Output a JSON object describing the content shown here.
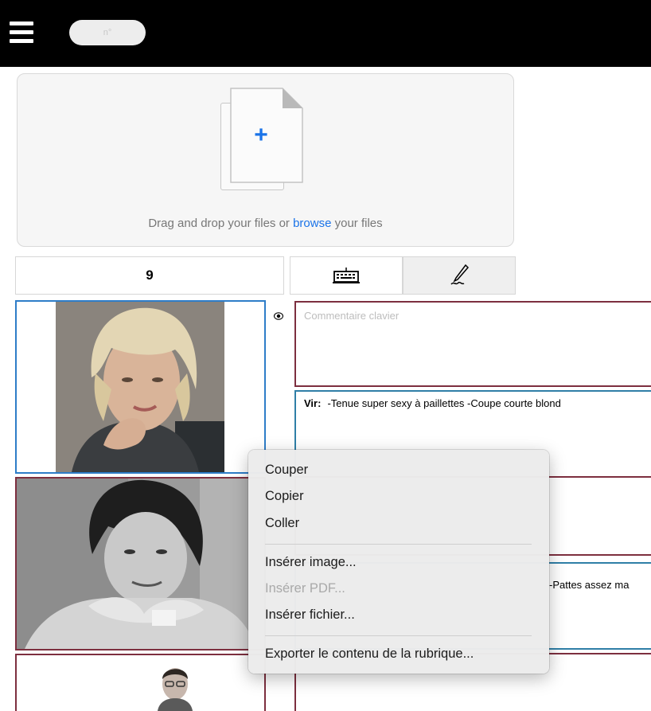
{
  "header": {
    "number_placeholder": "n°"
  },
  "dropzone": {
    "text_before": "Drag and drop your files or ",
    "browse_link": "browse",
    "text_after": " your files",
    "plus": "+"
  },
  "toolbar": {
    "count": "9"
  },
  "record": {
    "comment_placeholder": "Commentaire clavier",
    "vir_label": "Vir:",
    "vir_text": "-Tenue super sexy à paillettes -Coupe courte blond",
    "row2_snippet": "-Pattes assez ma"
  },
  "context_menu": {
    "items": [
      "Couper",
      "Copier",
      "Coller",
      "Insérer image...",
      "Insérer PDF...",
      "Insérer fichier...",
      "Exporter le contenu de la rubrique..."
    ],
    "disabled_index": 4
  },
  "colors": {
    "topbar": "#000000",
    "link": "#1a73e8",
    "comment_border": "#7d2f3f",
    "text_border": "#2f7fa7",
    "selected_photo_border": "#2e7dc8"
  }
}
